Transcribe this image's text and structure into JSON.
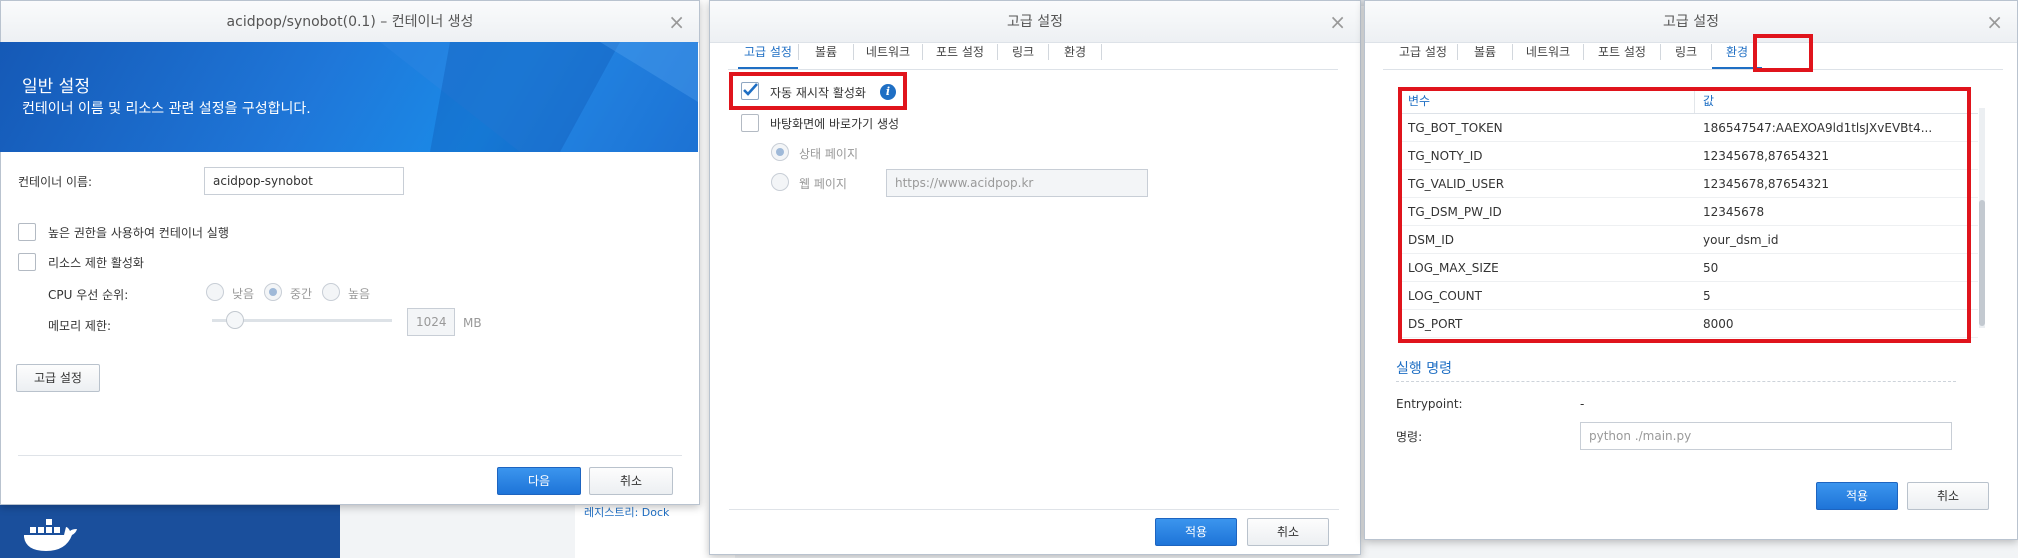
{
  "window1": {
    "title": "acidpop/synobot(0.1) – 컨테이너 생성",
    "hero_title": "일반 설정",
    "hero_subtitle": "컨테이너 이름 및 리소스 관련 설정을 구성합니다.",
    "container_name_label": "컨테이너 이름:",
    "container_name_value": "acidpop-synobot",
    "privileged_label": "높은 권한을 사용하여 컨테이너 실행",
    "resource_limit_label": "리소스 제한 활성화",
    "cpu_priority_label": "CPU 우선 순위:",
    "cpu_low": "낮음",
    "cpu_mid": "중간",
    "cpu_high": "높음",
    "memory_limit_label": "메모리 제한:",
    "memory_value": "1024",
    "memory_unit": "MB",
    "advanced_button": "고급 설정",
    "next_button": "다음",
    "cancel_button": "취소"
  },
  "background": {
    "registry_label": "레지스트리: Dock"
  },
  "window2": {
    "title": "고급 설정",
    "tabs": [
      "고급 설정",
      "볼륨",
      "네트워크",
      "포트 설정",
      "링크",
      "환경"
    ],
    "auto_restart_label": "자동 재시작 활성화",
    "info_icon_glyph": "i",
    "desktop_shortcut_label": "바탕화면에 바로가기 생성",
    "status_page_label": "상태 페이지",
    "web_page_label": "웹 페이지",
    "web_page_url": "https://www.acidpop.kr",
    "apply_button": "적용",
    "cancel_button": "취소"
  },
  "window3": {
    "title": "고급 설정",
    "tabs": [
      "고급 설정",
      "볼륨",
      "네트워크",
      "포트 설정",
      "링크",
      "환경"
    ],
    "env_table": {
      "col_variable": "변수",
      "col_value": "값",
      "rows": [
        {
          "name": "TG_BOT_TOKEN",
          "value": "186547547:AAEXOA9ld1tlsJXvEVBt4..."
        },
        {
          "name": "TG_NOTY_ID",
          "value": "12345678,87654321"
        },
        {
          "name": "TG_VALID_USER",
          "value": "12345678,87654321"
        },
        {
          "name": "TG_DSM_PW_ID",
          "value": "12345678"
        },
        {
          "name": "DSM_ID",
          "value": "your_dsm_id"
        },
        {
          "name": "LOG_MAX_SIZE",
          "value": "50"
        },
        {
          "name": "LOG_COUNT",
          "value": "5"
        },
        {
          "name": "DS_PORT",
          "value": "8000"
        }
      ]
    },
    "exec_section_title": "실행 명령",
    "entrypoint_label": "Entrypoint:",
    "entrypoint_value": "-",
    "command_label": "명령:",
    "command_placeholder": "python ./main.py",
    "apply_button": "적용",
    "cancel_button": "취소"
  },
  "colors": {
    "accent": "#1f6fc4",
    "highlight_red": "#e0141c",
    "hero_blue": "#1a74d6"
  }
}
